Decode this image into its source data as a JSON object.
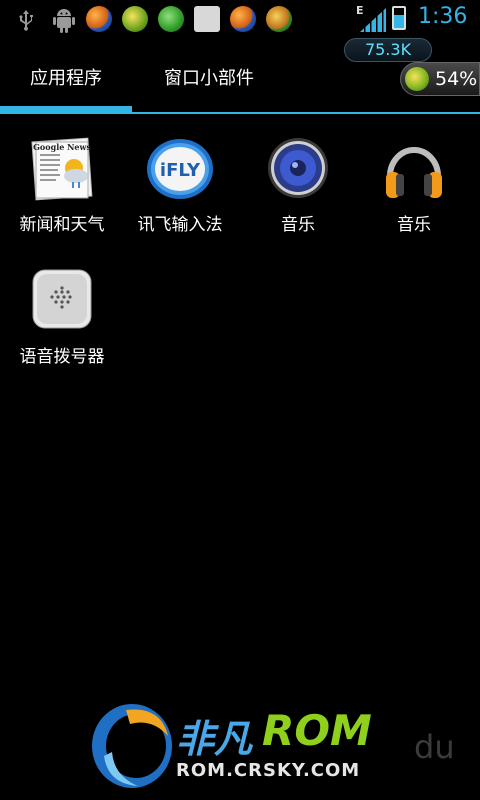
{
  "status_bar": {
    "time": "1:36",
    "network_type": "E",
    "icons": [
      "usb-icon",
      "android-debug-icon",
      "app-notification-icon",
      "plus-app-icon",
      "shield-plus-icon",
      "gallery-icon",
      "app-notification-icon",
      "refresh-app-icon",
      "signal-icon",
      "battery-charging-icon"
    ]
  },
  "widgets": {
    "speed_value": "75.3K",
    "battery_percent": "54%"
  },
  "tabs": {
    "apps_label": "应用程序",
    "widgets_label": "窗口小部件",
    "active": "apps"
  },
  "apps": [
    {
      "label": "新闻和天气",
      "icon": "google-news-icon"
    },
    {
      "label": "讯飞输入法",
      "icon": "ifly-icon"
    },
    {
      "label": "音乐",
      "icon": "speaker-icon"
    },
    {
      "label": "音乐",
      "icon": "headphones-icon"
    },
    {
      "label": "语音拨号器",
      "icon": "voice-dialer-icon"
    }
  ],
  "news_icon_text": "Google News",
  "ifly_icon_text": "iFLY",
  "watermark": {
    "brand_cn": "非凡",
    "brand_rom": "ROM",
    "url": "ROM.CRSKY.COM",
    "du": "du"
  },
  "colors": {
    "accent": "#33b5e5",
    "background": "#000000"
  }
}
